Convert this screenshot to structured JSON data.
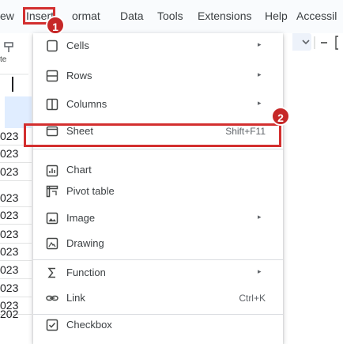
{
  "menubar": {
    "items": [
      {
        "label": "ew"
      },
      {
        "label": "Insert"
      },
      {
        "label": "ormat"
      },
      {
        "label": "Data"
      },
      {
        "label": "Tools"
      },
      {
        "label": "Extensions"
      },
      {
        "label": "Help"
      },
      {
        "label": "Accessil"
      }
    ]
  },
  "left_strip": {
    "label_te": "te",
    "cells": [
      "023",
      "023",
      "023",
      "023",
      "023",
      "023",
      "023",
      "023",
      "023",
      "023",
      "202"
    ]
  },
  "menu": {
    "items": [
      {
        "label": "Cells",
        "icon": "cell-icon",
        "submenu": true
      },
      {
        "label": "Rows",
        "icon": "rows-icon",
        "submenu": true
      },
      {
        "label": "Columns",
        "icon": "columns-icon",
        "submenu": true
      },
      {
        "label": "Sheet",
        "icon": "sheet-icon",
        "shortcut": "Shift+F11"
      },
      {
        "label": "Chart",
        "icon": "chart-icon"
      },
      {
        "label": "Pivot table",
        "icon": "pivot-table-icon"
      },
      {
        "label": "Image",
        "icon": "image-icon",
        "submenu": true
      },
      {
        "label": "Drawing",
        "icon": "drawing-icon"
      },
      {
        "label": "Function",
        "icon": "sigma-icon",
        "submenu": true
      },
      {
        "label": "Link",
        "icon": "link-icon",
        "shortcut": "Ctrl+K"
      },
      {
        "label": "Checkbox",
        "icon": "checkbox-icon"
      }
    ],
    "arrow_glyph": "▸"
  },
  "annotations": {
    "badge1": "1",
    "badge2": "2",
    "color": "#d32f2f"
  }
}
